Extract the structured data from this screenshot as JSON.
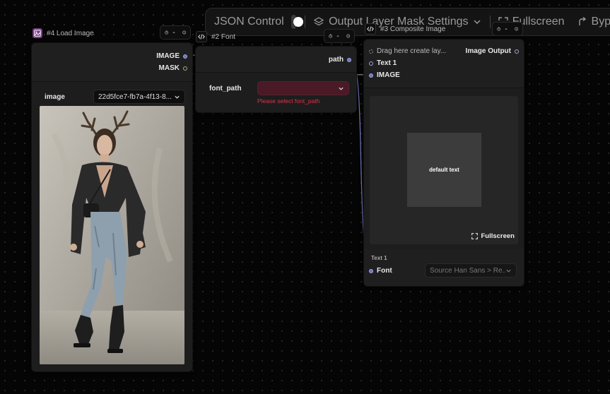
{
  "toolbar": {
    "json_control_label": "JSON Control",
    "output_layer_mask_label": "Output Layer Mask Settings",
    "fullscreen_label": "Fullscreen",
    "bypass_label": "Bypass"
  },
  "load_image_node": {
    "title": "#4 Load Image",
    "output_image": "IMAGE",
    "output_mask": "MASK",
    "widget_label": "image",
    "widget_value": "22d5fce7-fb7a-4f13-8..."
  },
  "font_node": {
    "title": "#2 Font",
    "output_path": "path",
    "widget_label": "font_path",
    "error_text": "Please select font_path"
  },
  "composite_node": {
    "title": "#3 Composite Image",
    "input_drag": "Drag here create lay...",
    "input_text": "Text 1",
    "input_image": "IMAGE",
    "output_image": "Image Output",
    "preview_text": "default text",
    "fullscreen_label": "Fullscreen",
    "section_label": "Text 1",
    "font_label": "Font",
    "font_value": "Source Han Sans > Re..."
  },
  "timer_button_label": "-",
  "colors": {
    "accent": "#6d73c8",
    "error": "#e0324a",
    "node_bg": "#1d1d1d",
    "canvas_bg": "#050505"
  }
}
